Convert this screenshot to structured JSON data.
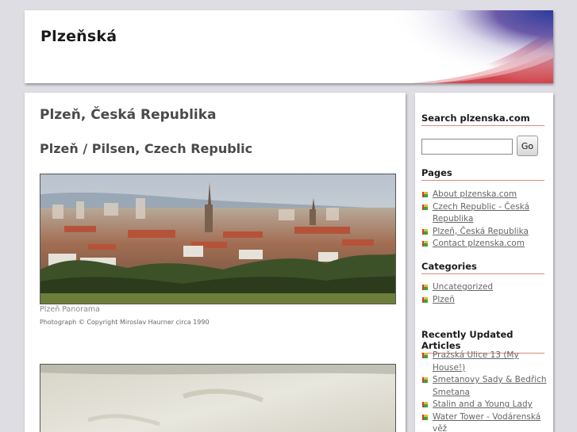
{
  "header": {
    "site_title": "Plzeňská"
  },
  "main": {
    "title": "Plzeň, Česká Republika",
    "subtitle": "Plzeň / Pilsen, Czech Republic",
    "panorama_caption": "Plzeň Panorama",
    "panorama_credit": "Photograph © Copyright Miroslav Haurner circa 1990"
  },
  "sidebar": {
    "search_title": "Search plzenska.com",
    "search_value": "",
    "search_button": "Go",
    "pages_title": "Pages",
    "pages": [
      "About plzenska.com",
      "Czech Republic - Česká Republika",
      "Plzeň, Česká Republika",
      "Contact plzenska.com"
    ],
    "categories_title": "Categories",
    "categories": [
      "Uncategorized",
      "Plzeň"
    ],
    "recent_title": "Recently Updated Articles",
    "recent": [
      "Pražská Ulice 13 (My House!)",
      "Smetanovy Sady & Bedřich Smetana",
      "Stalin and a Young Lady",
      "Water Tower - Vodárenská věž"
    ]
  },
  "colors": {
    "page_background": "#dedde4",
    "widget_rule": "#d98c7a",
    "flag_blue": "#2c3b9c",
    "flag_red": "#c8262e"
  }
}
